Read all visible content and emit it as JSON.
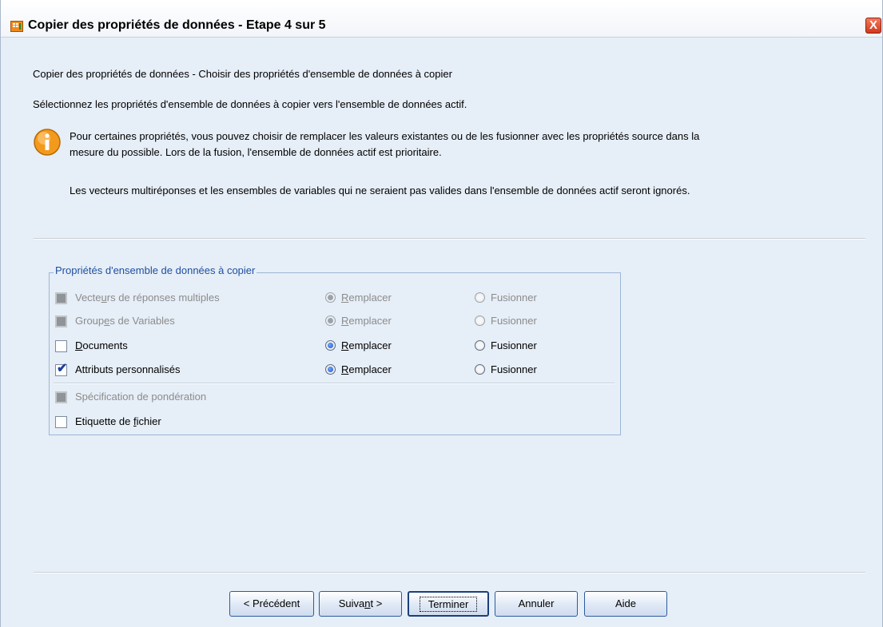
{
  "window": {
    "title": "Copier des propriétés de données - Etape 4 sur 5",
    "close_glyph": "X"
  },
  "content": {
    "heading": "Copier des propriétés de données - Choisir des propriétés d'ensemble de données à copier",
    "instruction": "Sélectionnez les propriétés d'ensemble de données à copier vers l'ensemble de données actif.",
    "info_line1": "Pour certaines propriétés, vous pouvez choisir de remplacer les valeurs existantes ou de les fusionner avec les propriétés source dans la",
    "info_line2": "mesure du possible.  Lors de la fusion, l'ensemble de données actif est prioritaire.",
    "note": "Les vecteurs multiréponses et les ensembles de variables qui ne seraient pas valides dans l'ensemble de données actif seront ignorés."
  },
  "group": {
    "legend": "Propriétés d'ensemble de données à copier",
    "rows": [
      {
        "label_pre": "Vecte",
        "label_u": "u",
        "label_post": "rs de réponses multiples",
        "checked": false,
        "enabled": false,
        "mode": "Remplacer"
      },
      {
        "label_pre": "Group",
        "label_u": "e",
        "label_post": "s de Variables",
        "checked": false,
        "enabled": false,
        "mode": "Remplacer"
      },
      {
        "label_pre": "",
        "label_u": "D",
        "label_post": "ocuments",
        "checked": false,
        "enabled": true,
        "mode": "Remplacer"
      },
      {
        "label_pre": "Attributs personnalisés",
        "label_u": "",
        "label_post": "",
        "checked": true,
        "enabled": true,
        "mode": "Remplacer"
      }
    ],
    "replace_u": "R",
    "replace_rest": "emplacer",
    "merge_label": "Fusionner",
    "weight_label": "Spécification de pondération",
    "file_label_pre": "Etiquette de ",
    "file_label_u": "f",
    "file_label_post": "ichier"
  },
  "buttons": {
    "prev": "< Précédent",
    "next_pre": "Suiva",
    "next_u": "n",
    "next_post": "t  >",
    "finish": "Terminer",
    "cancel": "Annuler",
    "help": "Aide"
  },
  "colors": {
    "background": "#e6eef7",
    "legend_text": "#1f4fa0",
    "close_button": "#d0391c",
    "info_icon": "#f39a1d"
  },
  "icons": {
    "app": "spss-data-table-icon",
    "info": "info-icon",
    "close": "close-icon"
  }
}
